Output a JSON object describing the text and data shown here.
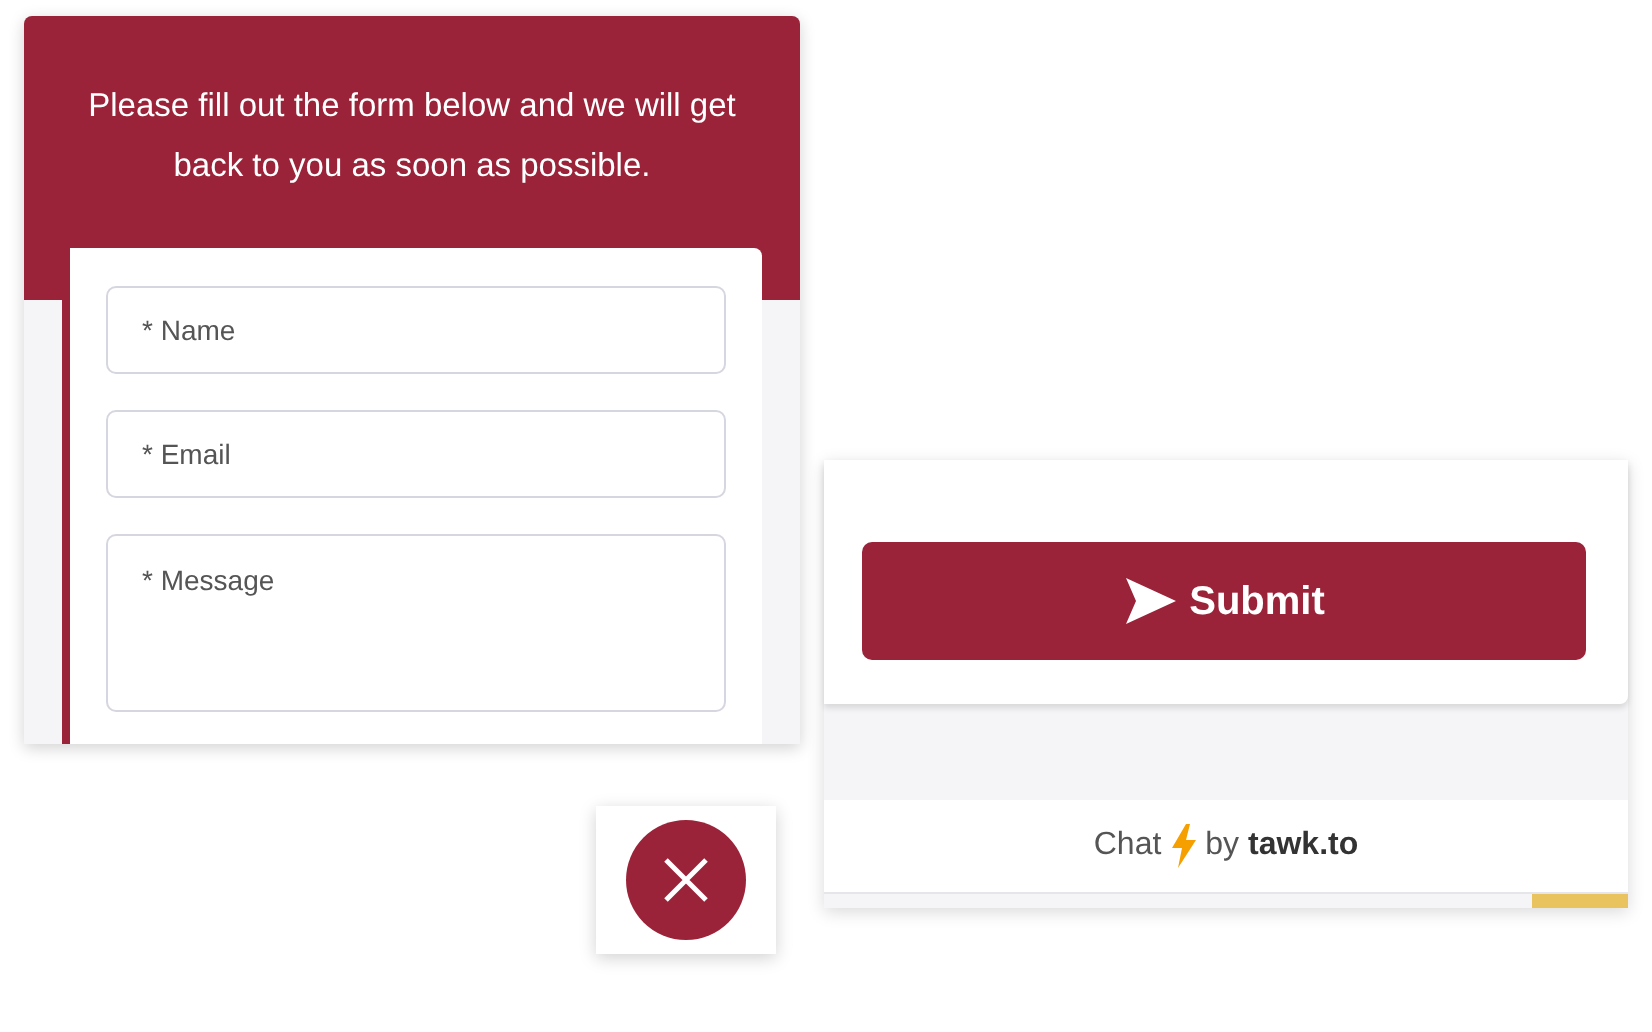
{
  "form": {
    "intro": "Please fill out the form below and we will get back to you as soon as possible.",
    "fields": [
      {
        "kind": "input",
        "placeholder": "* Name"
      },
      {
        "kind": "input",
        "placeholder": "* Email"
      },
      {
        "kind": "textarea",
        "placeholder": "* Message"
      }
    ]
  },
  "submit": {
    "label": "Submit"
  },
  "footer": {
    "chat": "Chat",
    "by": "by **tawk.to**"
  }
}
